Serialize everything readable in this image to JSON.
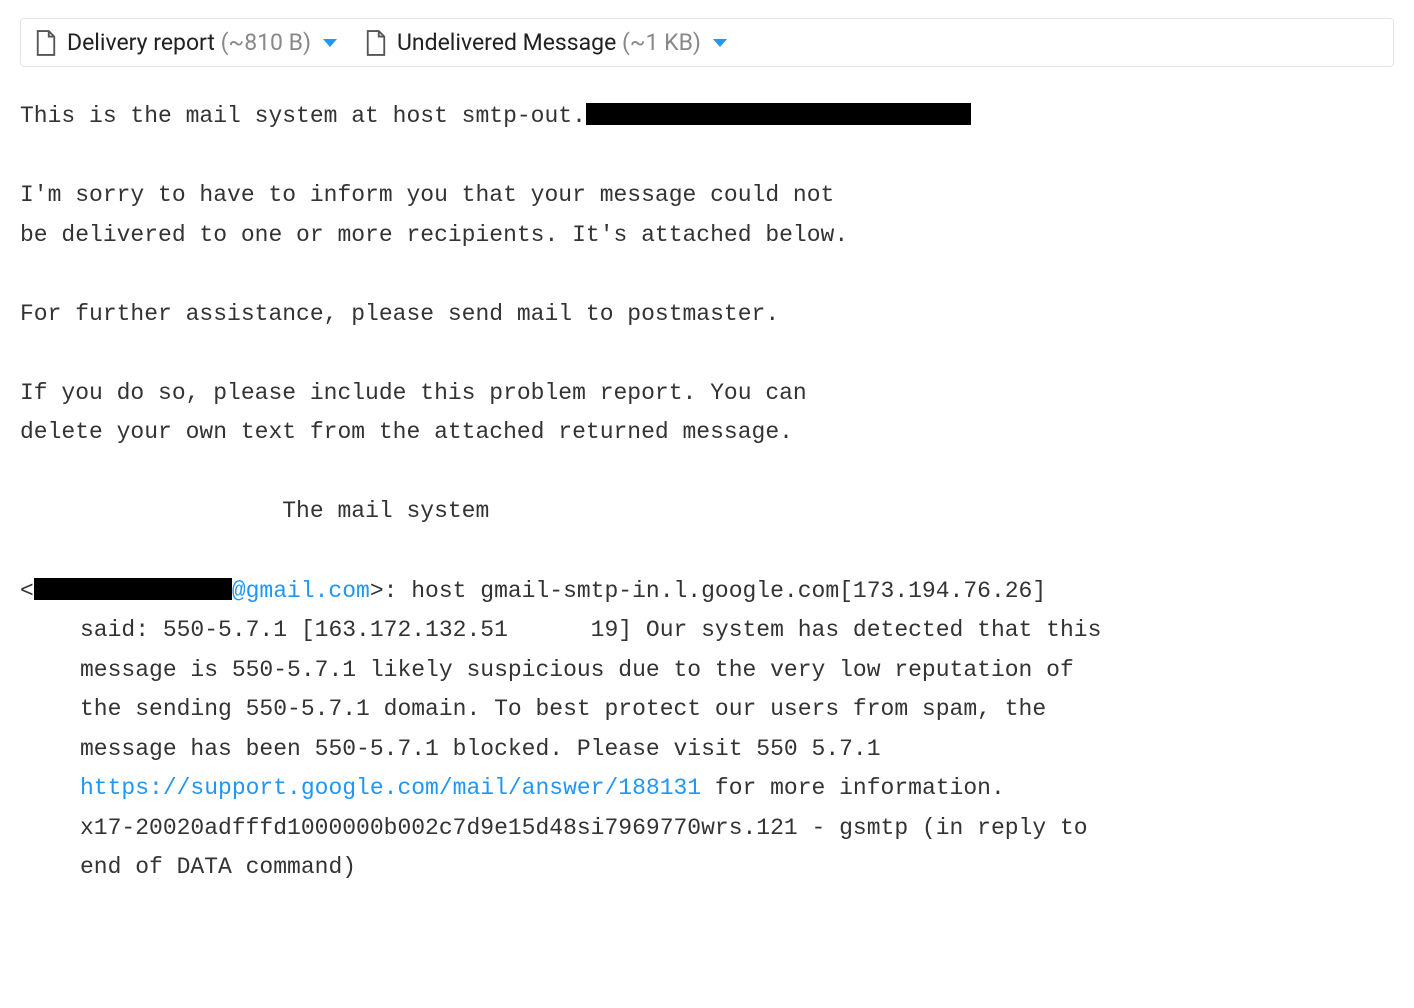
{
  "attachments": [
    {
      "name": "Delivery report",
      "size": "(~810 B)"
    },
    {
      "name": "Undelivered Message",
      "size": "(~1 KB)"
    }
  ],
  "body": {
    "line_host_prefix": "This is the mail system at host smtp-out.",
    "para_sorry": "I'm sorry to have to inform you that your message could not\nbe delivered to one or more recipients. It's attached below.",
    "para_further": "For further assistance, please send mail to postmaster.",
    "para_include": "If you do so, please include this problem report. You can\ndelete your own text from the attached returned message.",
    "centered": "                   The mail system",
    "diag_open": "<",
    "diag_email_domain": "@gmail.com",
    "diag_after_email": ">: host gmail-smtp-in.l.google.com[173.194.76.26]",
    "diag_block_1": "said: 550-5.7.1 [163.172.132.51      19] Our system has detected that this\nmessage is 550-5.7.1 likely suspicious due to the very low reputation of\nthe sending 550-5.7.1 domain. To best protect our users from spam, the\nmessage has been 550-5.7.1 blocked. Please visit 550 5.7.1",
    "diag_link": "https://support.google.com/mail/answer/188131",
    "diag_block_2": " for more information.\nx17-20020adfffd1000000b002c7d9e15d48si7969770wrs.121 - gsmtp (in reply to\nend of DATA command)"
  }
}
